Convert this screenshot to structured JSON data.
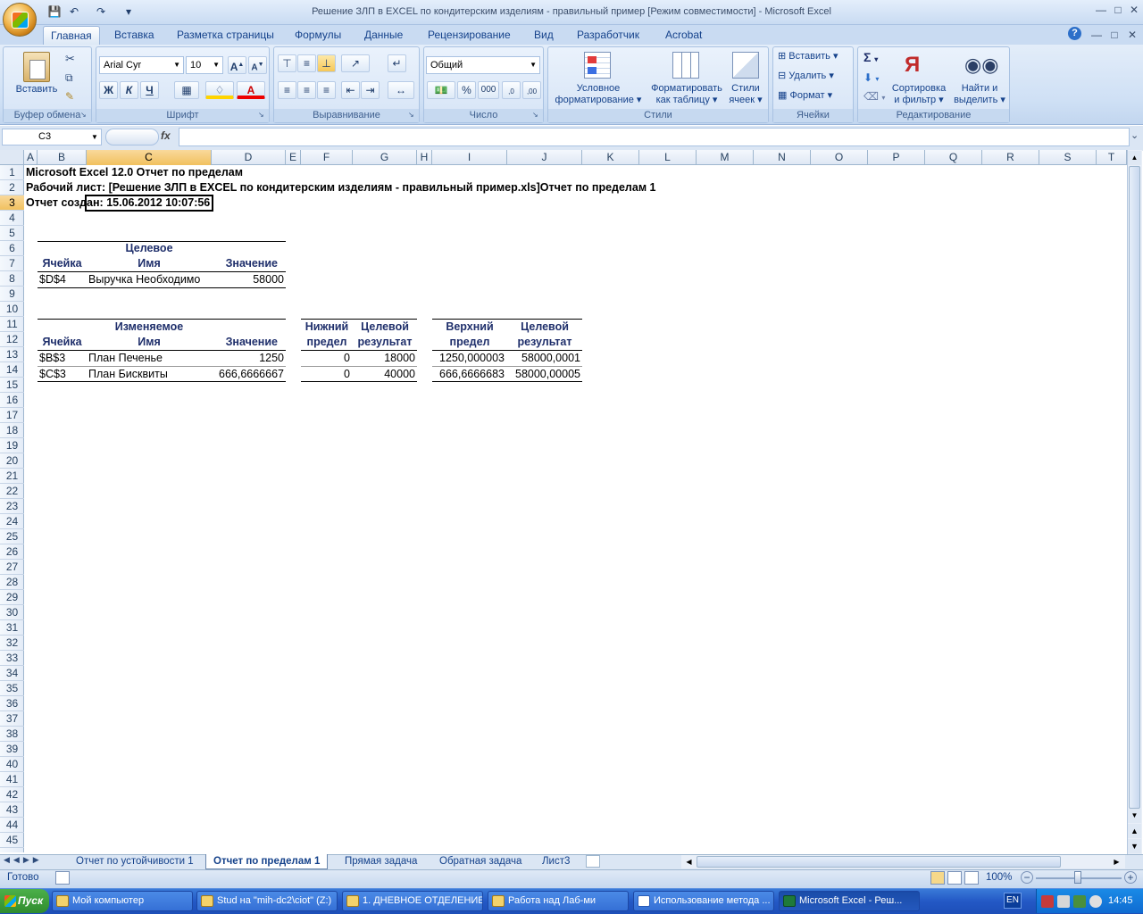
{
  "window": {
    "title": "Решение ЗЛП в EXCEL по кондитерским изделиям - правильный пример  [Режим совместимости] - Microsoft Excel"
  },
  "ribbon_tabs": [
    "Главная",
    "Вставка",
    "Разметка страницы",
    "Формулы",
    "Данные",
    "Рецензирование",
    "Вид",
    "Разработчик",
    "Acrobat"
  ],
  "ribbon": {
    "clipboard": {
      "label": "Буфер обмена",
      "paste": "Вставить"
    },
    "font": {
      "label": "Шрифт",
      "name": "Arial Cyr",
      "size": "10",
      "bold": "Ж",
      "italic": "К",
      "underline": "Ч",
      "color": "А"
    },
    "alignment": {
      "label": "Выравнивание"
    },
    "number": {
      "label": "Число",
      "format": "Общий",
      "percent": "%",
      "thousands": "000"
    },
    "styles": {
      "label": "Стили",
      "conditional_l1": "Условное",
      "conditional_l2": "форматирование",
      "table_l1": "Форматировать",
      "table_l2": "как таблицу",
      "cell_l1": "Стили",
      "cell_l2": "ячеек"
    },
    "cells": {
      "label": "Ячейки",
      "insert": "Вставить",
      "delete": "Удалить",
      "format": "Формат"
    },
    "editing": {
      "label": "Редактирование",
      "sort_l1": "Сортировка",
      "sort_l2": "и фильтр",
      "find_l1": "Найти и",
      "find_l2": "выделить"
    }
  },
  "formula_bar": {
    "name_box": "C3",
    "fx": "fx",
    "value": ""
  },
  "columns": [
    "A",
    "B",
    "C",
    "D",
    "E",
    "F",
    "G",
    "H",
    "I",
    "J",
    "K",
    "L",
    "M",
    "N",
    "O",
    "P",
    "Q",
    "R",
    "S",
    "T"
  ],
  "selected_column": "C",
  "selected_row": 3,
  "rows": [
    "1",
    "2",
    "3",
    "4",
    "5",
    "6",
    "7",
    "8",
    "9",
    "10",
    "11",
    "12",
    "13",
    "14",
    "15",
    "16",
    "17",
    "18",
    "19",
    "20",
    "21",
    "22",
    "23",
    "24",
    "25",
    "26",
    "27",
    "28",
    "29",
    "30",
    "31",
    "32",
    "33",
    "34",
    "35",
    "36",
    "37",
    "38",
    "39",
    "40",
    "41",
    "42",
    "43",
    "44",
    "45"
  ],
  "report": {
    "line1": "Microsoft Excel 12.0 Отчет по пределам",
    "line2": "Рабочий лист: [Решение ЗЛП в EXCEL по кондитерским изделиям - правильный пример.xls]Отчет по пределам 1",
    "line3": "Отчет создан: 15.06.2012 10:07:56",
    "target": {
      "h_top": "Целевое",
      "h_cell": "Ячейка",
      "h_name": "Имя",
      "h_value": "Значение",
      "row": {
        "cell": "$D$4",
        "name": "Выручка Необходимо",
        "value": "58000"
      }
    },
    "variables": {
      "h_top": "Изменяемое",
      "h_cell": "Ячейка",
      "h_name": "Имя",
      "h_value": "Значение",
      "h_lower_1": "Нижний",
      "h_lower_2": "предел",
      "h_result_1": "Целевой",
      "h_result_2": "результат",
      "h_upper_1": "Верхний",
      "h_upper_2": "предел",
      "h_result2_1": "Целевой",
      "h_result2_2": "результат",
      "rows": [
        {
          "cell": "$B$3",
          "name": "План Печенье",
          "value": "1250",
          "lower": "0",
          "lower_result": "18000",
          "upper": "1250,000003",
          "upper_result": "58000,0001"
        },
        {
          "cell": "$C$3",
          "name": "План Бисквиты",
          "value": "666,6666667",
          "lower": "0",
          "lower_result": "40000",
          "upper": "666,6666683",
          "upper_result": "58000,00005"
        }
      ]
    }
  },
  "sheet_tabs": [
    "Отчет по устойчивости 1",
    "Отчет по пределам 1",
    "Прямая задача",
    "Обратная задача",
    "Лист3"
  ],
  "active_sheet": "Отчет по пределам 1",
  "status": {
    "ready": "Готово",
    "zoom": "100%"
  },
  "taskbar": {
    "start": "Пуск",
    "tasks": [
      "Мой компьютер",
      "Stud на \"mih-dc2\\ciot\" (Z:)",
      "1. ДНЕВНОЕ ОТДЕЛЕНИЕ",
      "Работа над Лаб-ми",
      "Использование метода ...",
      "Microsoft Excel - Реш..."
    ],
    "lang": "EN",
    "clock": "14:45"
  }
}
